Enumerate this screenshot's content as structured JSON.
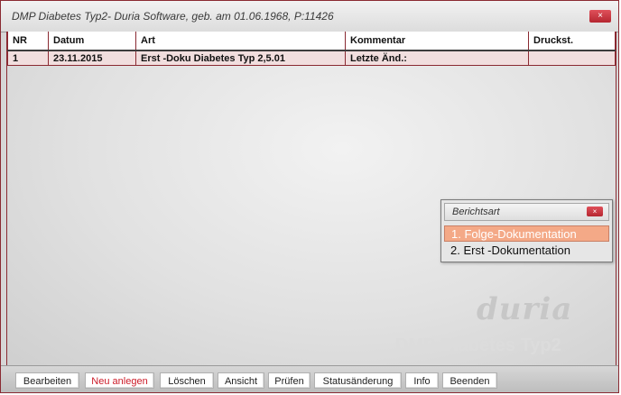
{
  "window": {
    "title": "DMP Diabetes Typ2- Duria Software, geb. am 01.06.1968, P:11426",
    "close_icon": "×"
  },
  "table": {
    "columns": [
      "NR",
      "Datum",
      "Art",
      "Kommentar",
      "Druckst."
    ],
    "rows": [
      {
        "nr": "1",
        "datum": "23.11.2015",
        "art": "Erst -Doku Diabetes Typ 2,5.01",
        "kommentar": "Letzte Änd.:",
        "druckst": ""
      }
    ]
  },
  "dialog": {
    "title": "Berichtsart",
    "close_icon": "×",
    "options": [
      "1. Folge-Dokumentation",
      "2. Erst -Dokumentation"
    ],
    "selected_index": 0
  },
  "branding": {
    "logo": "duria",
    "product": "DMP Diabetes Typ2"
  },
  "toolbar": {
    "buttons": [
      "Bearbeiten",
      "Neu anlegen",
      "Löschen",
      "Ansicht",
      "Prüfen",
      "Statusänderung",
      "Info",
      "Beenden"
    ],
    "active_index": 1
  },
  "colors": {
    "accent_border": "#8a2a32",
    "selected_option": "#f4a987",
    "active_button_text": "#cc1b28"
  }
}
